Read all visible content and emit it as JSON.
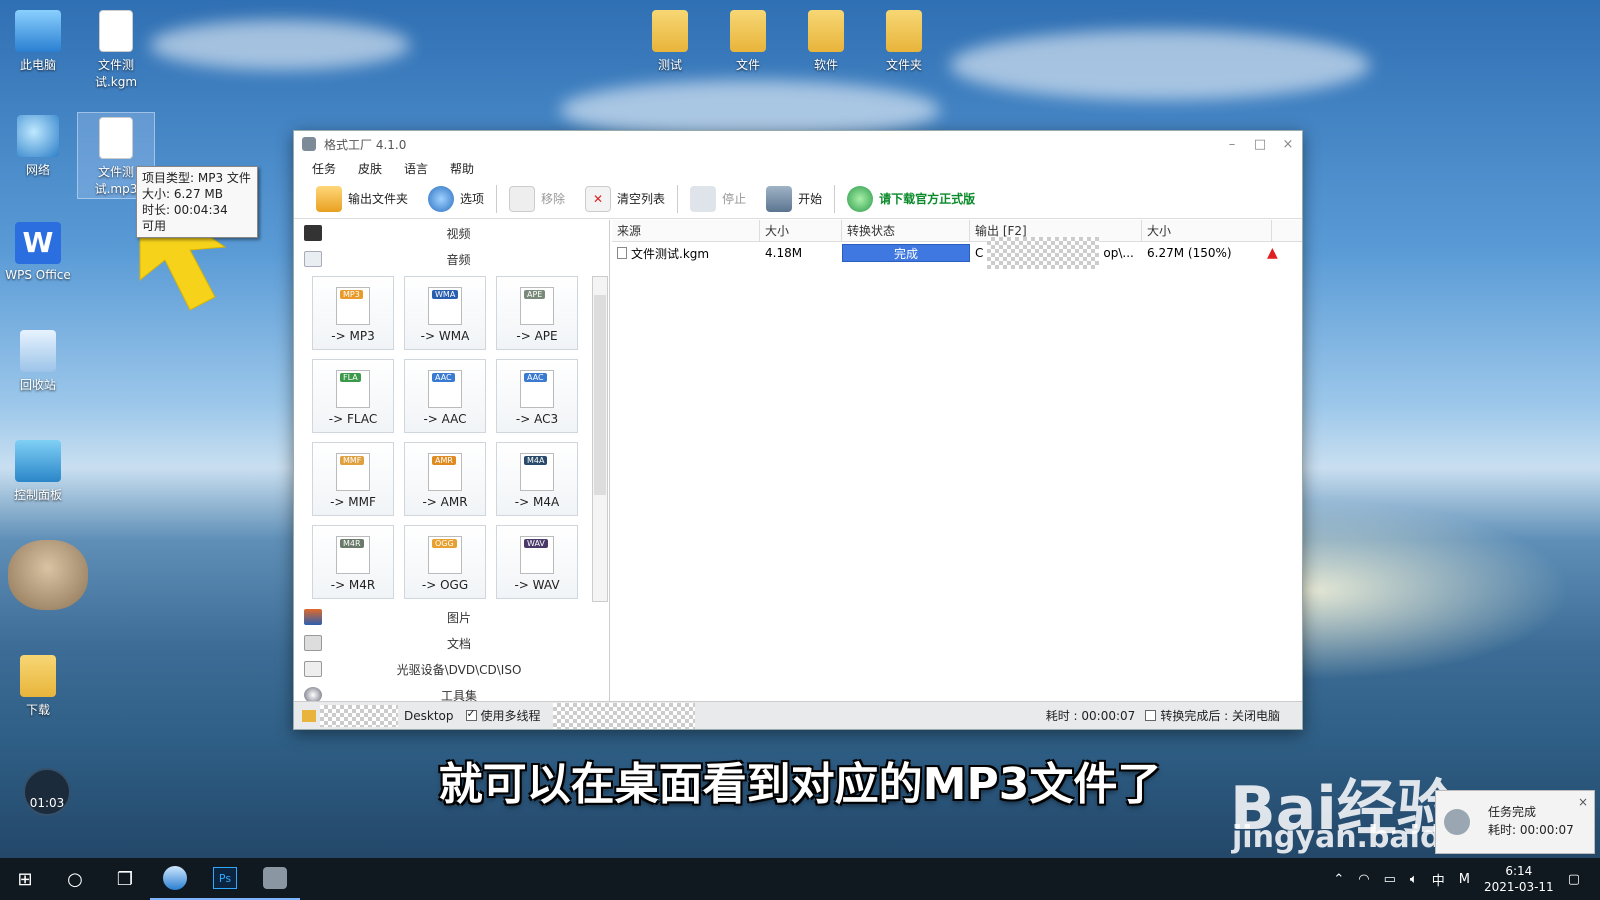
{
  "desktop": {
    "icons": [
      {
        "label": "此电脑"
      },
      {
        "label": "文件测试.kgm"
      },
      {
        "label": "网络"
      },
      {
        "label": "文件测试.mp3"
      },
      {
        "label": "WPS Office"
      },
      {
        "label": "回收站"
      },
      {
        "label": "控制面板"
      },
      {
        "label": "下载"
      },
      {
        "label": "测试"
      },
      {
        "label": "文件"
      },
      {
        "label": "软件"
      },
      {
        "label": "文件夹"
      }
    ],
    "wps_glyph": "W",
    "tooltip": {
      "line1": "项目类型: MP3 文件",
      "line2": "大小: 6.27 MB",
      "line3": "时长: 00:04:34",
      "line4": "可用"
    },
    "timer": "01:03"
  },
  "window": {
    "title": "格式工厂 4.1.0",
    "controls": {
      "min": "–",
      "max": "□",
      "close": "×"
    },
    "menu": [
      "任务",
      "皮肤",
      "语言",
      "帮助"
    ],
    "toolbar": {
      "output_folder": "输出文件夹",
      "options": "选项",
      "remove": "移除",
      "clear_list": "清空列表",
      "stop": "停止",
      "start": "开始",
      "download": "请下载官方正式版"
    },
    "categories_top": [
      "视频",
      "音频"
    ],
    "formats": [
      "-> MP3",
      "-> WMA",
      "-> APE",
      "-> FLAC",
      "-> AAC",
      "-> AC3",
      "-> MMF",
      "-> AMR",
      "-> M4A",
      "-> M4R",
      "-> OGG",
      "-> WAV"
    ],
    "format_badges": [
      "MP3",
      "WMA",
      "APE",
      "FLA",
      "AAC",
      "AAC",
      "MMF",
      "AMR",
      "M4A",
      "M4R",
      "OGG",
      "WAV"
    ],
    "categories_bottom": [
      "图片",
      "文档",
      "光驱设备\\DVD\\CD\\ISO",
      "工具集"
    ],
    "table": {
      "headers": [
        "来源",
        "大小",
        "转换状态",
        "输出 [F2]",
        "大小"
      ],
      "row": {
        "source": "文件测试.kgm",
        "size": "4.18M",
        "status": "完成",
        "status_progress": 1.0,
        "output_prefix": "C",
        "output_suffix": "op\\...",
        "out_size": "6.27M  (150%)"
      }
    },
    "status": {
      "folder": "Desktop",
      "multithread": "使用多线程",
      "multithread_checked": true,
      "elapsed": "耗时 : 00:00:07",
      "after_done": "转换完成后 : 关闭电脑",
      "after_done_checked": false
    }
  },
  "subtitle": "就可以在桌面看到对应的MP3文件了",
  "watermark": {
    "line1": "Bai经验",
    "line2": "jingyan.baidu.com"
  },
  "notification": {
    "title": "任务完成",
    "detail": "耗时: 00:00:07"
  },
  "taskbar": {
    "tray_ime": "中",
    "tray_m": "M",
    "time": "6:14",
    "date": "2021-03-11"
  }
}
